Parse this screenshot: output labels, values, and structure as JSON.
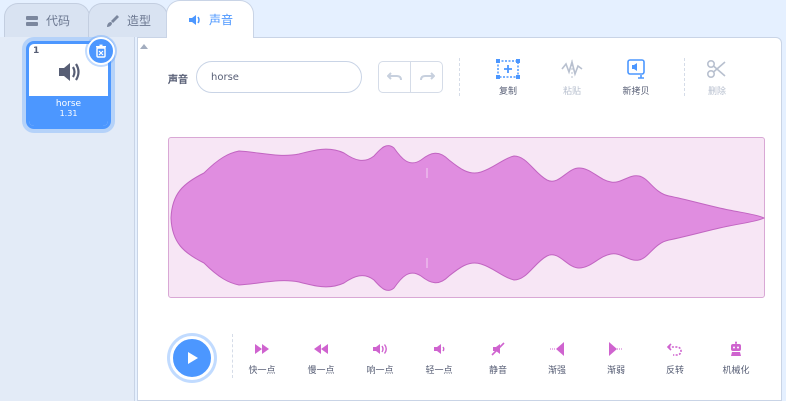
{
  "tabs": [
    {
      "label": "代码",
      "icon": "code-icon"
    },
    {
      "label": "造型",
      "icon": "brush-icon"
    },
    {
      "label": "声音",
      "icon": "speaker-icon"
    }
  ],
  "sound_list": {
    "items": [
      {
        "index": "1",
        "name": "horse",
        "duration": "1.31",
        "icon": "speaker-icon"
      }
    ]
  },
  "editor": {
    "sound_label": "声音",
    "sound_name": "horse",
    "tools": {
      "copy": "复制",
      "paste": "粘贴",
      "copy_to_new": "新拷贝",
      "delete": "删除"
    },
    "effects": [
      {
        "label": "快一点",
        "icon": "faster-icon"
      },
      {
        "label": "慢一点",
        "icon": "slower-icon"
      },
      {
        "label": "响一点",
        "icon": "louder-icon"
      },
      {
        "label": "轻一点",
        "icon": "softer-icon"
      },
      {
        "label": "静音",
        "icon": "mute-icon"
      },
      {
        "label": "渐强",
        "icon": "fade-in-icon"
      },
      {
        "label": "渐弱",
        "icon": "fade-out-icon"
      },
      {
        "label": "反转",
        "icon": "reverse-icon"
      },
      {
        "label": "机械化",
        "icon": "robot-icon"
      }
    ]
  },
  "colors": {
    "accent": "#4c97ff",
    "sound_magenta": "#cf63cf",
    "waveform_fill": "#e08de0",
    "waveform_bg": "#f7e6f5",
    "disabled": "#b8c0cf"
  }
}
